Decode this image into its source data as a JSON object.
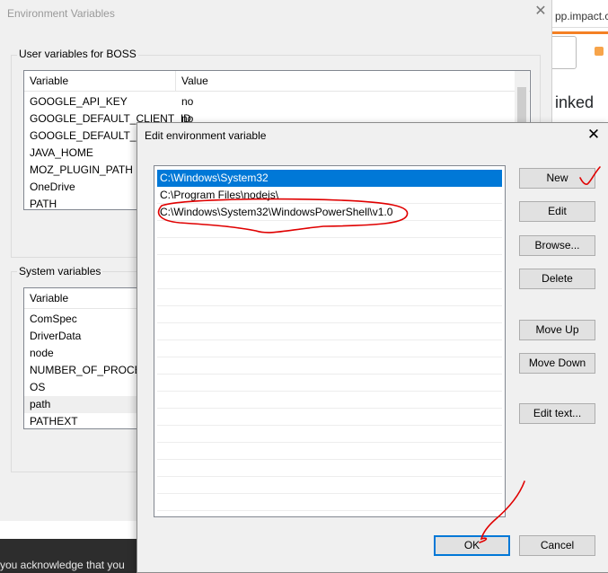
{
  "background": {
    "url_fragment": "pp.impact.c",
    "linked_text": "inked",
    "cookie_text": "you acknowledge that you"
  },
  "env_dialog": {
    "title": "Environment Variables",
    "user_group_label": "User variables for BOSS",
    "user_headers": {
      "variable": "Variable",
      "value": "Value"
    },
    "user_rows": [
      {
        "variable": "GOOGLE_API_KEY",
        "value": "no"
      },
      {
        "variable": "GOOGLE_DEFAULT_CLIENT_ID",
        "value": "no"
      },
      {
        "variable": "GOOGLE_DEFAULT_CLI",
        "value": ""
      },
      {
        "variable": "JAVA_HOME",
        "value": ""
      },
      {
        "variable": "MOZ_PLUGIN_PATH",
        "value": ""
      },
      {
        "variable": "OneDrive",
        "value": ""
      },
      {
        "variable": "PATH",
        "value": ""
      }
    ],
    "system_group_label": "System variables",
    "system_header": "Variable",
    "system_rows": [
      {
        "variable": "ComSpec"
      },
      {
        "variable": "DriverData"
      },
      {
        "variable": "node"
      },
      {
        "variable": "NUMBER_OF_PROCESS"
      },
      {
        "variable": "OS"
      },
      {
        "variable": "path"
      },
      {
        "variable": "PATHEXT"
      }
    ]
  },
  "edit_dialog": {
    "title": "Edit environment variable",
    "entries": [
      "C:\\Windows\\System32",
      "C:\\Program Files\\nodejs\\",
      "C:\\Windows\\System32\\WindowsPowerShell\\v1.0"
    ],
    "selected_index": 0,
    "buttons": {
      "new": "New",
      "edit": "Edit",
      "browse": "Browse...",
      "delete": "Delete",
      "move_up": "Move Up",
      "move_down": "Move Down",
      "edit_text": "Edit text...",
      "ok": "OK",
      "cancel": "Cancel"
    }
  },
  "colors": {
    "selection": "#0078d7",
    "annotation": "#e00000",
    "dialog_bg": "#f0f0f0"
  }
}
